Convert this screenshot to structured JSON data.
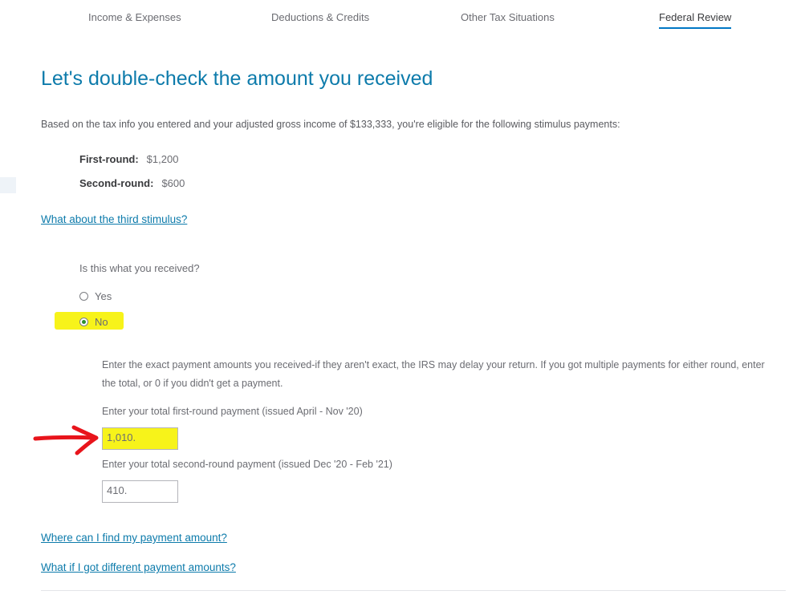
{
  "tabs": [
    {
      "label": "Income & Expenses",
      "active": false
    },
    {
      "label": "Deductions & Credits",
      "active": false
    },
    {
      "label": "Other Tax Situations",
      "active": false
    },
    {
      "label": "Federal Review",
      "active": true
    }
  ],
  "page": {
    "title": "Let's double-check the amount you received",
    "intro": "Based on the tax info you entered and your adjusted gross income of $133,333, you're eligible for the following stimulus payments:"
  },
  "payments": [
    {
      "label": "First-round:",
      "amount": "$1,200"
    },
    {
      "label": "Second-round:",
      "amount": "$600"
    }
  ],
  "links": {
    "third_stimulus": "What about the third stimulus?",
    "find_amount": "Where can I find my payment amount?",
    "different_amounts": "What if I got different payment amounts?"
  },
  "question": {
    "label": "Is this what you received?",
    "options": [
      "Yes",
      "No"
    ],
    "selected": "No"
  },
  "instructions": "Enter the exact payment amounts you received-if they aren't exact, the IRS may delay your return. If you got multiple payments for either round, enter the total, or 0 if you didn't get a payment.",
  "fields": {
    "first_round": {
      "label": "Enter your total first-round payment (issued April - Nov '20)",
      "value": "1,010."
    },
    "second_round": {
      "label": "Enter your total second-round payment (issued Dec '20 - Feb '21)",
      "value": "410."
    }
  },
  "annotations": {
    "highlight_color": "#f7f31a",
    "arrow_color": "#e8141b",
    "accent": "#0d7bab"
  }
}
